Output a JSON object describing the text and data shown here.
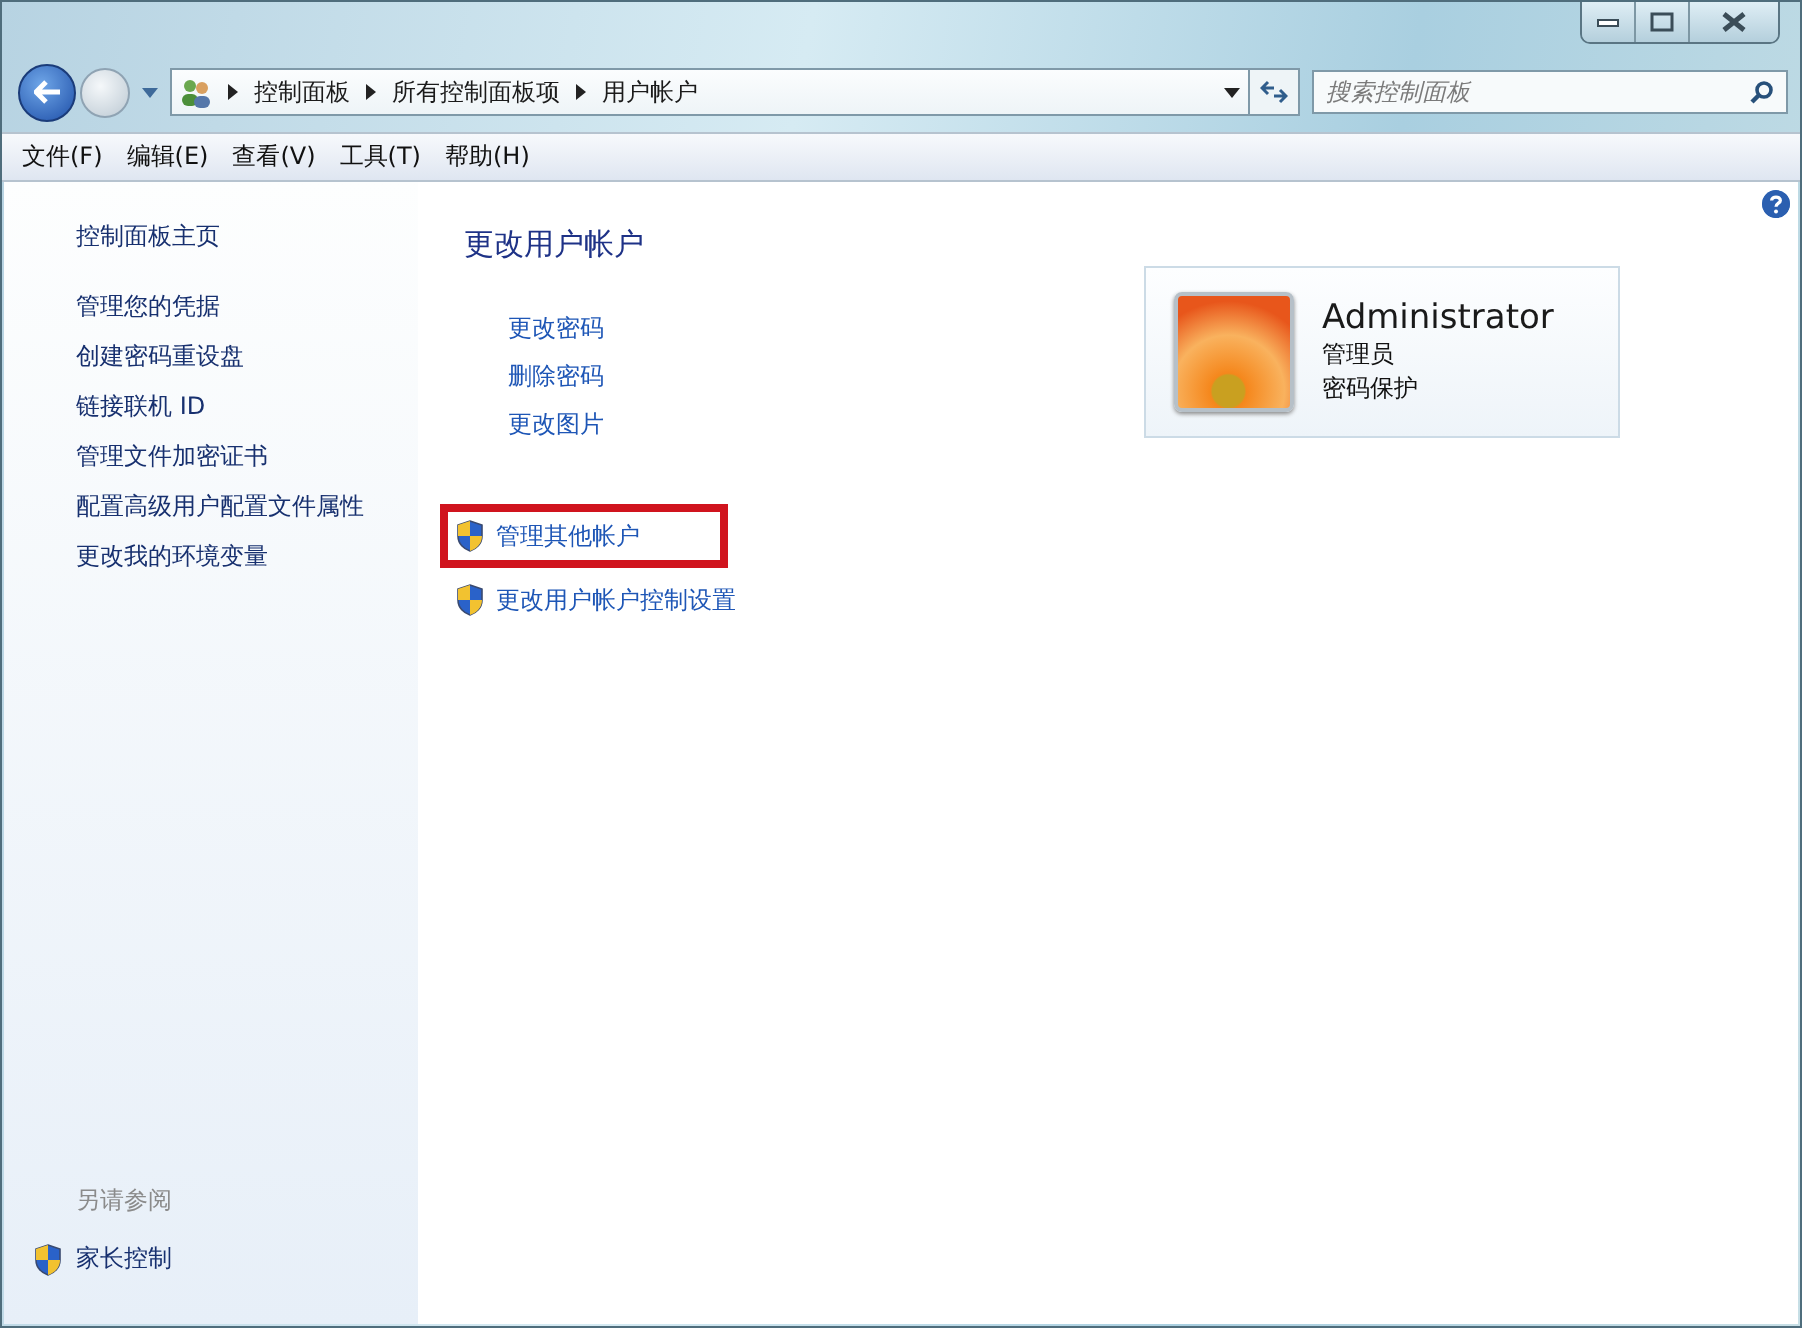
{
  "breadcrumb": [
    "控制面板",
    "所有控制面板项",
    "用户帐户"
  ],
  "search": {
    "placeholder": "搜索控制面板"
  },
  "menu": [
    "文件(F)",
    "编辑(E)",
    "查看(V)",
    "工具(T)",
    "帮助(H)"
  ],
  "sidebar": {
    "home": "控制面板主页",
    "items": [
      "管理您的凭据",
      "创建密码重设盘",
      "链接联机 ID",
      "管理文件加密证书",
      "配置高级用户配置文件属性",
      "更改我的环境变量"
    ],
    "see_also_title": "另请参阅",
    "see_also": [
      {
        "label": "家长控制",
        "kind": "shield"
      }
    ]
  },
  "main": {
    "heading": "更改用户帐户",
    "links": [
      "更改密码",
      "删除密码",
      "更改图片"
    ],
    "admin_links": [
      {
        "label": "管理其他帐户",
        "kind": "shield",
        "highlighted": true
      },
      {
        "label": "更改用户帐户控制设置",
        "kind": "shield",
        "highlighted": false
      }
    ]
  },
  "account": {
    "name": "Administrator",
    "role": "管理员",
    "status": "密码保护"
  }
}
